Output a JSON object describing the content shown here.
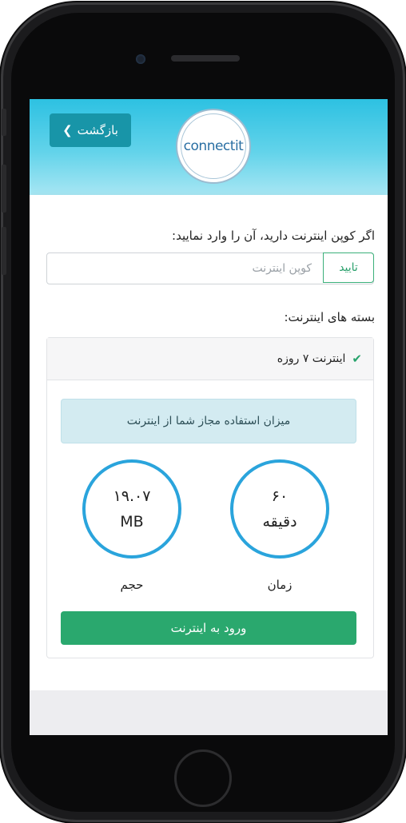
{
  "header": {
    "back_label": "بازگشت",
    "back_chevron": "‹",
    "logo_text": "connectit"
  },
  "coupon": {
    "label": "اگر کوپن اینترنت دارید، آن را وارد نمایید:",
    "placeholder": "کوپن اینترنت",
    "value": "",
    "confirm_label": "تایید"
  },
  "packages": {
    "label": "بسته های اینترنت:",
    "selected_package": {
      "check": "✔",
      "name": "اینترنت ۷ روزه",
      "usage_title": "میزان استفاده مجاز شما از اینترنت",
      "volume": {
        "value": "۱۹.۰۷",
        "unit": "MB",
        "label": "حجم"
      },
      "time": {
        "value": "۶۰",
        "unit": "دقیقه",
        "label": "زمان"
      },
      "login_label": "ورود به اینترنت"
    }
  },
  "colors": {
    "header_accent": "#2dc1e2",
    "back_button": "#1895a8",
    "confirm_green": "#2aa06c",
    "circle_blue": "#2aa4dc",
    "login_button": "#2aa86e",
    "usage_box": "#d3ebf1"
  }
}
